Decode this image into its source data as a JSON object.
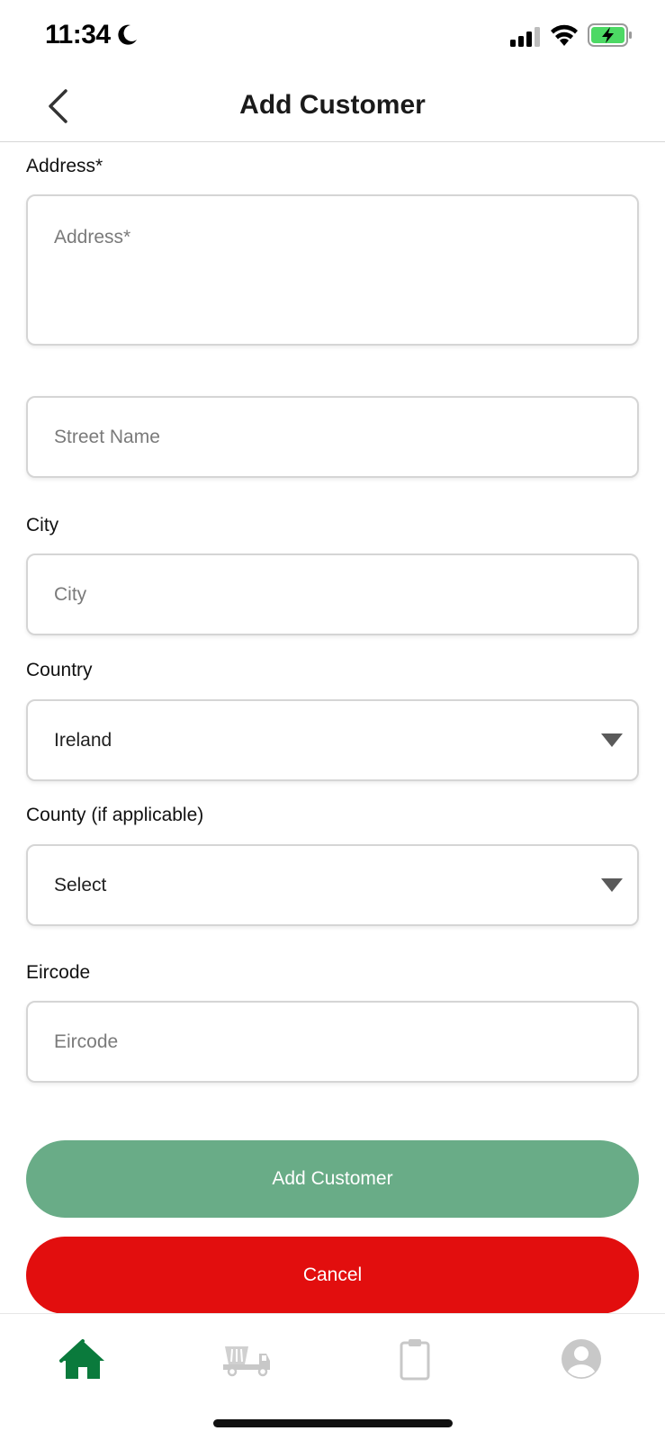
{
  "status_bar": {
    "time": "11:34",
    "icons": [
      "moon-icon",
      "signal-icon",
      "wifi-icon",
      "battery-charging-icon"
    ],
    "battery_color": "#4cd964"
  },
  "nav": {
    "title": "Add Customer",
    "back_icon": "chevron-left-icon"
  },
  "form": {
    "address": {
      "label": "Address*",
      "placeholder": "Address*"
    },
    "street": {
      "placeholder": "Street Name"
    },
    "city": {
      "label": "City",
      "placeholder": "City"
    },
    "country": {
      "label": "Country",
      "value": "Ireland"
    },
    "county": {
      "label": "County (if applicable)",
      "value": "Select"
    },
    "eircode": {
      "label": "Eircode",
      "placeholder": "Eircode"
    }
  },
  "buttons": {
    "add_customer": "Add Customer",
    "cancel": "Cancel"
  },
  "tab_bar": {
    "tabs": [
      {
        "icon": "home-icon",
        "active": true
      },
      {
        "icon": "skip-truck-icon",
        "active": false
      },
      {
        "icon": "clipboard-icon",
        "active": false
      },
      {
        "icon": "profile-icon",
        "active": false
      }
    ]
  },
  "colors": {
    "primary_green": "#0a7a3c",
    "add_button": "#69ac87",
    "cancel_button": "#e20e0e",
    "inactive_icon": "#c8c8c8"
  }
}
